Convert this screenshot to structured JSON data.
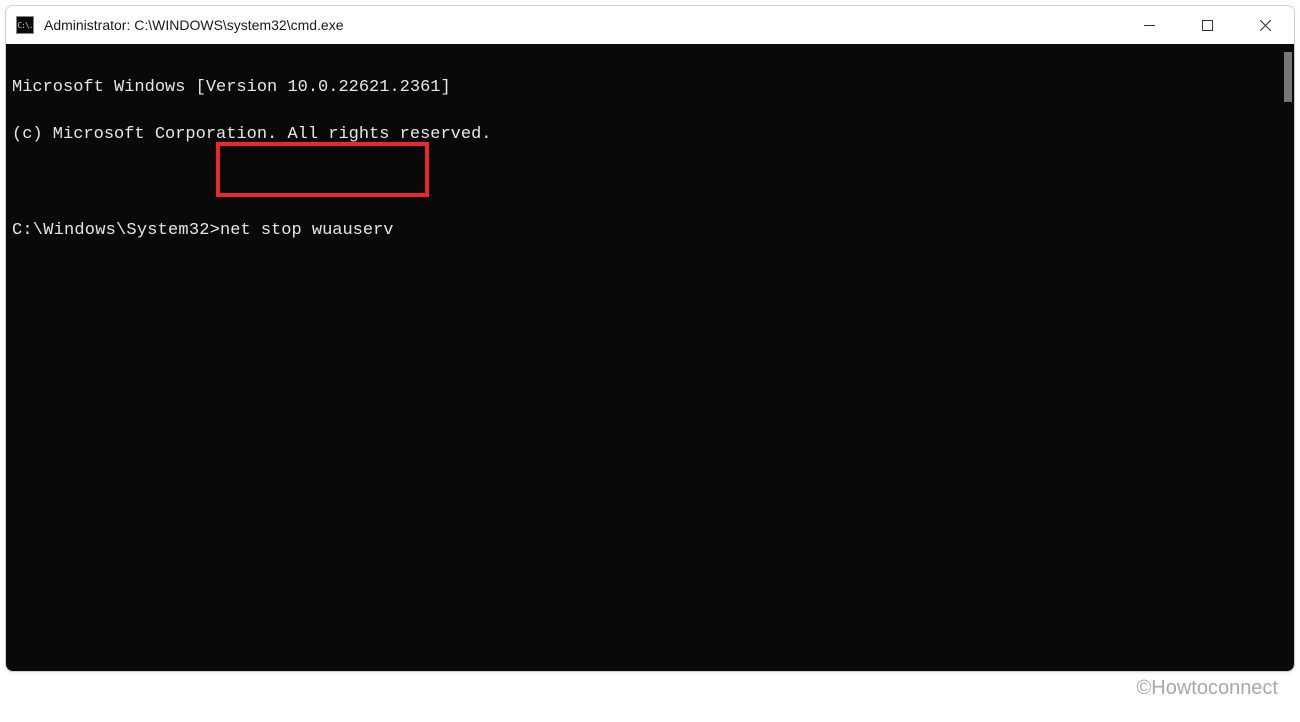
{
  "window": {
    "title": "Administrator: C:\\WINDOWS\\system32\\cmd.exe",
    "icon_label": "C:\\."
  },
  "terminal": {
    "line1": "Microsoft Windows [Version 10.0.22621.2361]",
    "line2": "(c) Microsoft Corporation. All rights reserved.",
    "prompt": "C:\\Windows\\System32>",
    "command": "net stop wuauserv"
  },
  "watermark": "©Howtoconnect"
}
